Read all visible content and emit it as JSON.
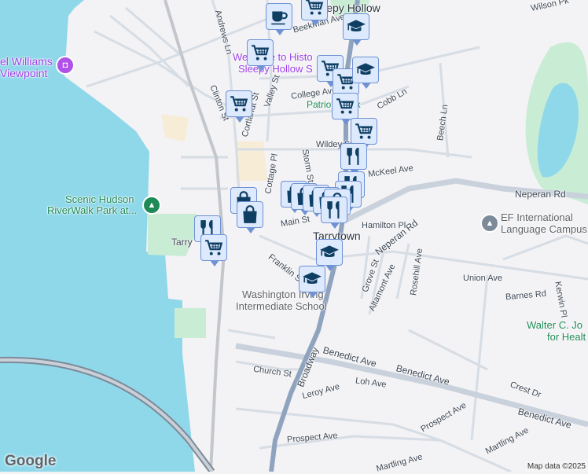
{
  "map": {
    "colors": {
      "water": "#8fd8ea",
      "land": "#f3f2f4",
      "park": "#c9ecd4",
      "road": "#d6dde5",
      "highway": "#8fa3bf",
      "marker_bg": "#dde9fc",
      "marker_icon": "#0e3f63",
      "poi": "#9b3fe6"
    },
    "places": {
      "sleepy_hollow": "Sleepy Hollow",
      "tarrytown": "Tarrytown",
      "viewpoint_1": "el Williams",
      "viewpoint_2": "Viewpoint",
      "welcome_1": "Welcome to Histo",
      "welcome_2": "Sleepy Hollow S",
      "riverwalk_1": "Scenic Hudson",
      "riverwalk_2": "RiverWalk Park at...",
      "ef_1": "EF International",
      "ef_2": "Language Campus",
      "washington_1": "Washington Irving",
      "washington_2": "Intermediate School",
      "walter_1": "Walter C. Jo",
      "walter_2": "for Healt",
      "patriots_park": "Patriots Park",
      "tarry": "Tarry"
    },
    "streets": {
      "wilson": "Wilson Pk",
      "beekman": "Beekman Ave",
      "andrews": "Andrews Ln",
      "clinton": "Clinton St",
      "cortlandt": "Cortlandt St",
      "valley": "Valley St",
      "college": "College Ave",
      "cobb": "Cobb Ln",
      "wildey": "Wildey St",
      "mckeel": "McKeel Ave",
      "beech": "Beech Ln",
      "neperan1": "Neperan Rd",
      "neperan2": "Neperan Rd",
      "hamilton": "Hamilton Pl",
      "main": "Main St",
      "storm": "Storm St",
      "cottage": "Cottage Pl",
      "franklin": "Franklin St",
      "grove": "Grove St",
      "altamont": "Altamont Ave",
      "rosehill": "Rosehill Ave",
      "union": "Union Ave",
      "barnes": "Barnes Rd",
      "kerwin": "Kerwin Pl",
      "broadway": "Broadway",
      "benedict1": "Benedict Ave",
      "benedict2": "Benedict Ave",
      "benedict3": "Benedict Ave",
      "church": "Church St",
      "leroy": "Leroy Ave",
      "loh": "Loh Ave",
      "crest": "Crest Dr",
      "prospect1": "Prospect Ave",
      "prospect2": "Prospect Ave",
      "martling1": "Martling Ave",
      "martling2": "Martling Ave"
    },
    "markers": [
      "coffee-icon",
      "cart-icon",
      "graduation-cap-icon",
      "cart-icon",
      "cart-icon",
      "cart-icon",
      "graduation-cap-icon",
      "cart-icon",
      "cart-icon",
      "cart-icon",
      "restaurant-icon",
      "restaurant-icon",
      "restaurant-icon",
      "shopping-bag-icon",
      "shopping-bag-icon",
      "shopping-bag-icon",
      "shopping-bag-icon",
      "shopping-bag-icon",
      "shopping-bag-icon",
      "shopping-bag-icon",
      "restaurant-icon",
      "restaurant-icon",
      "cart-icon",
      "graduation-cap-icon",
      "graduation-cap-icon"
    ],
    "logo": "Google",
    "attribution": "Map data ©2025"
  }
}
